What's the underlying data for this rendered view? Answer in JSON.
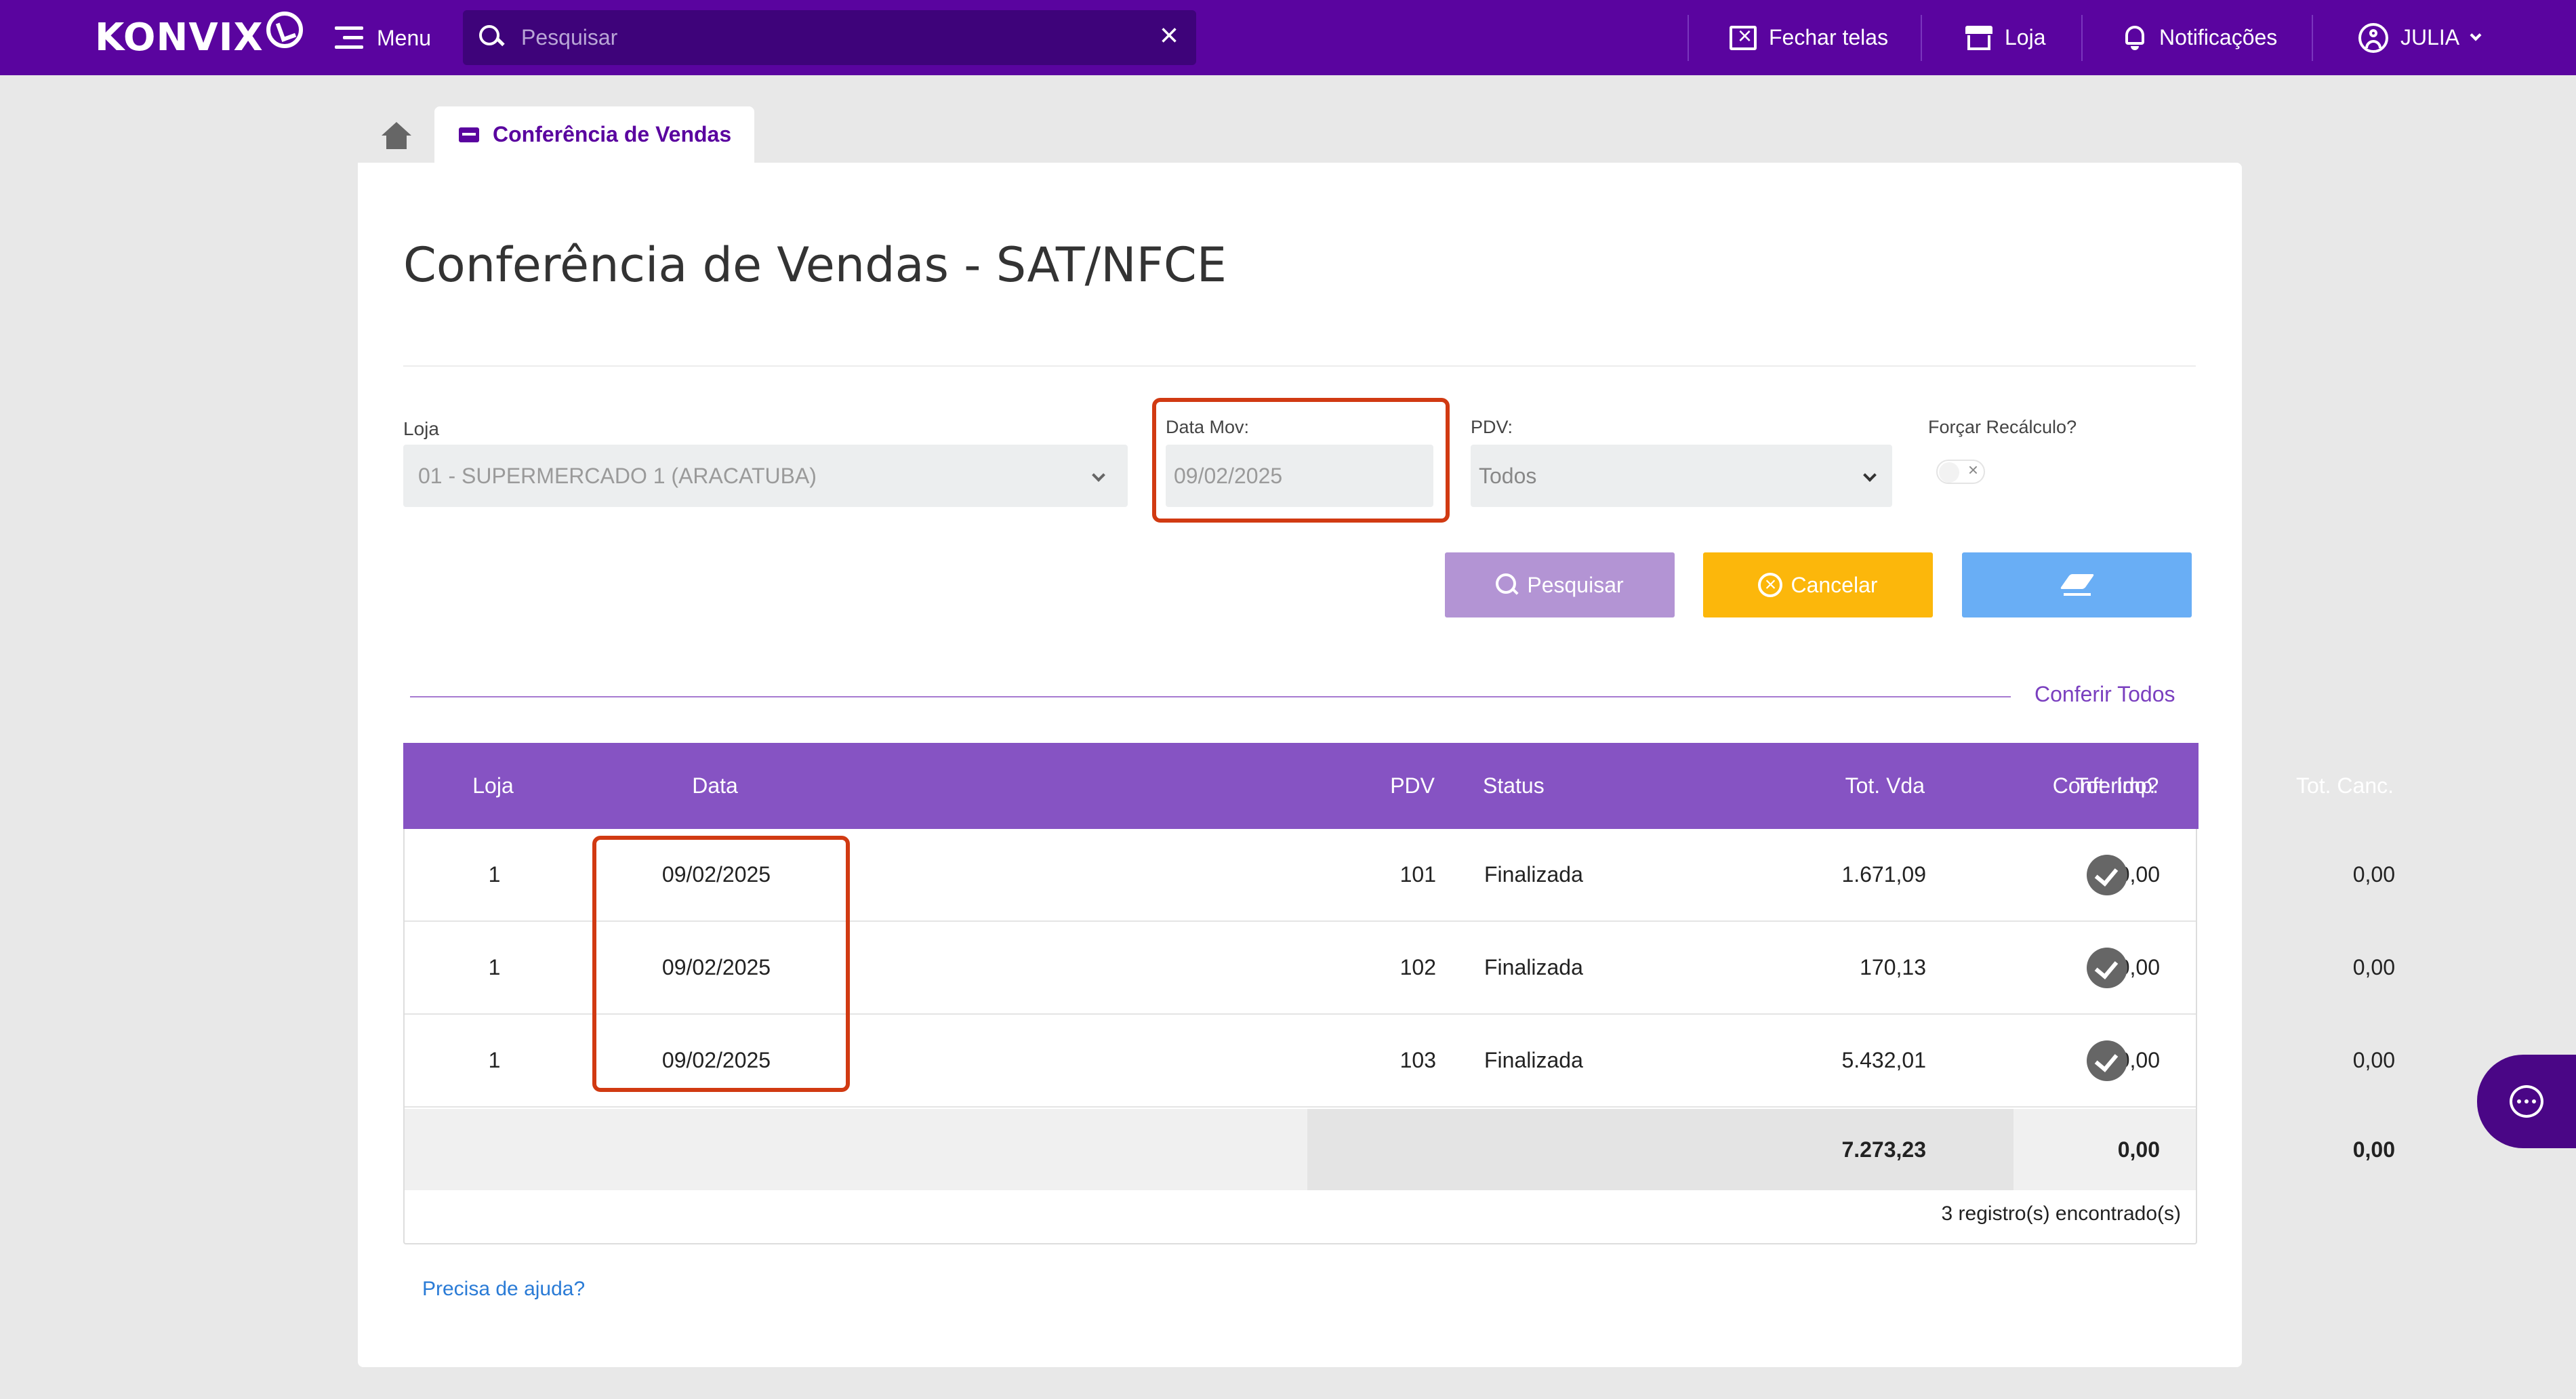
{
  "topbar": {
    "brand": "KONVIX",
    "menu_label": "Menu",
    "search_placeholder": "Pesquisar",
    "search_value": "",
    "nav": {
      "close_screens": "Fechar telas",
      "store": "Loja",
      "notifications": "Notificações",
      "user": "JULIA"
    }
  },
  "tabs": {
    "active": "Conferência de Vendas"
  },
  "page": {
    "title": "Conferência de Vendas - SAT/NFCE"
  },
  "filters": {
    "store_label": "Loja",
    "store_value": "01 - SUPERMERCADO 1 (ARACATUBA)",
    "date_label": "Data Mov:",
    "date_value": "09/02/2025",
    "pdv_label": "PDV:",
    "pdv_value": "Todos",
    "force_label": "Forçar Recálculo?",
    "force_value": false
  },
  "buttons": {
    "search": "Pesquisar",
    "cancel": "Cancelar"
  },
  "section": {
    "check_all": "Conferir Todos"
  },
  "table": {
    "headers": [
      "Loja",
      "Data",
      "PDV",
      "Status",
      "Tot. Vda",
      "Tot. Imp.",
      "Tot. Canc.",
      "Conferido?"
    ],
    "rows": [
      {
        "loja": "1",
        "data": "09/02/2025",
        "pdv": "101",
        "status": "Finalizada",
        "tot_vda": "1.671,09",
        "tot_imp": "0,00",
        "tot_canc": "0,00",
        "conferido": true
      },
      {
        "loja": "1",
        "data": "09/02/2025",
        "pdv": "102",
        "status": "Finalizada",
        "tot_vda": "170,13",
        "tot_imp": "0,00",
        "tot_canc": "0,00",
        "conferido": true
      },
      {
        "loja": "1",
        "data": "09/02/2025",
        "pdv": "103",
        "status": "Finalizada",
        "tot_vda": "5.432,01",
        "tot_imp": "0,00",
        "tot_canc": "0,00",
        "conferido": true
      }
    ],
    "totals": {
      "tot_vda": "7.273,23",
      "tot_imp": "0,00",
      "tot_canc": "0,00"
    },
    "record_count": "3 registro(s) encontrado(s)"
  },
  "footer": {
    "help": "Precisa de ajuda?"
  },
  "colors": {
    "topbar": "#5a049f",
    "table_header": "#8653c3",
    "highlight": "#d13a12",
    "btn_search": "#b394d4",
    "btn_cancel": "#fcb70b",
    "btn_clear": "#69aef5"
  }
}
